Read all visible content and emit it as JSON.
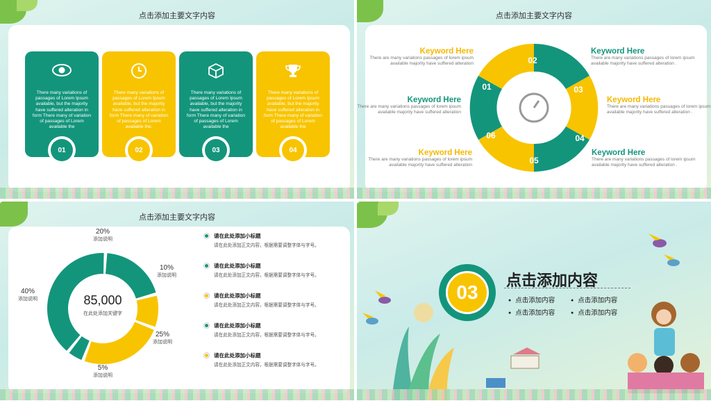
{
  "slide1": {
    "title": "点击添加主要文字内容",
    "cards": [
      {
        "num": "01",
        "icon": "eye-icon",
        "text": "There many variations of passages of Lorem Ipsum available, but the majority have suffered alteration in form There many of variation of passages of Lorem available the"
      },
      {
        "num": "02",
        "icon": "clock-icon",
        "text": "There many variations of passages of Lorem Ipsum available, but the majority have suffered alteration in form There many of variation of passages of Lorem available the."
      },
      {
        "num": "03",
        "icon": "cube-icon",
        "text": "There many variations of passages of Lorem Ipsum available, but the majority have suffered alteration in form There many of variation of passages of Lorem available the"
      },
      {
        "num": "04",
        "icon": "trophy-icon",
        "text": "There many variations of passages of Lorem Ipsum available, but the majority have suffered alteration in form There many of variation of passages of Lorem available the"
      }
    ]
  },
  "slide2": {
    "title": "点击添加主要文字内容",
    "keywords": [
      {
        "title": "Keyword Here",
        "desc": "There are many variations passages of lorem ipsum available majority have suffered alteration"
      },
      {
        "title": "Keyword Here",
        "desc": "There are many variations passages of lorem ipsum available majority have suffered alteration"
      },
      {
        "title": "Keyword Here",
        "desc": "There are many variations passages of lorem ipsum available majority have suffered alteration"
      },
      {
        "title": "Keyword Here",
        "desc": "There are many variations passages of lorem ipsum available majority have suffered alteration ."
      },
      {
        "title": "Keyword Here",
        "desc": "There are many variations passages of lorem ipsum available majority have suffered alteration ."
      },
      {
        "title": "Keyword Here",
        "desc": "There are many variations passages of lorem ipsum available majority have suffered alteration ."
      }
    ],
    "segments": [
      "01",
      "02",
      "03",
      "04",
      "05",
      "06"
    ]
  },
  "slide3": {
    "title": "点击添加主要文字内容",
    "center_value": "85,000",
    "center_caption": "在此处添加关键字",
    "bullets": [
      {
        "title": "请在此处添加小标题",
        "body": "请在此处添加正文内容，根据需要调整字体与字号。",
        "color": "#13957c"
      },
      {
        "title": "请在此处添加小标题",
        "body": "请在此处添加正文内容，根据需要调整字体与字号。",
        "color": "#13957c"
      },
      {
        "title": "请在此处添加小标题",
        "body": "请在此处添加正文内容，根据需要调整字体与字号。",
        "color": "#f8c400"
      },
      {
        "title": "请在此处添加小标题",
        "body": "请在此处添加正文内容，根据需要调整字体与字号。",
        "color": "#13957c"
      },
      {
        "title": "请在此处添加小标题",
        "body": "请在此处添加正文内容，根据需要调整字体与字号。",
        "color": "#f8c400"
      }
    ]
  },
  "slide4": {
    "section_number": "03",
    "heading": "点击添加内容",
    "items": [
      "点击添加内容",
      "点击添加内容",
      "点击添加内容",
      "点击添加内容"
    ]
  },
  "chart_data": {
    "type": "pie",
    "style": "donut",
    "categories": [
      "添加说明",
      "添加说明",
      "添加说明",
      "添加说明"
    ],
    "values": [
      20,
      10,
      25,
      5,
      40
    ],
    "labels": [
      "20%",
      "10%",
      "25%",
      "5%",
      "40%"
    ],
    "captions": [
      "添加说明",
      "添加说明",
      "添加说明",
      "添加说明",
      "添加说明"
    ],
    "colors": [
      "#13957c",
      "#f8c400",
      "#f8c400",
      "#13957c",
      "#13957c"
    ]
  },
  "colors": {
    "green": "#13957c",
    "yellow": "#f8c400"
  }
}
